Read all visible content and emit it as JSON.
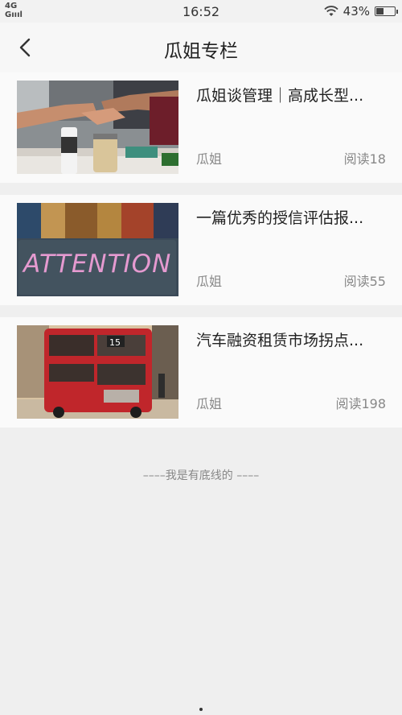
{
  "status": {
    "network": "4G",
    "time": "16:52",
    "battery": "43%",
    "battery_level": 0.43
  },
  "nav": {
    "title": "瓜姐专栏"
  },
  "articles": [
    {
      "title": "瓜姐谈管理｜高成长型...",
      "author": "瓜姐",
      "reads": "阅读18",
      "image": "hands-teamwork-photo"
    },
    {
      "title": "一篇优秀的授信评估报...",
      "author": "瓜姐",
      "reads": "阅读55",
      "image": "attention-chalkboard-photo",
      "image_text": "ATTENTION"
    },
    {
      "title": "汽车融资租赁市场拐点...",
      "author": "瓜姐",
      "reads": "阅读198",
      "image": "red-double-decker-bus-photo",
      "image_text": "15"
    }
  ],
  "footer": {
    "text": "––––我是有底线的 ––––"
  },
  "colors": {
    "background": "#efefef",
    "card": "#fafafa",
    "bus_red": "#c0262b",
    "chalk_pink": "#e59ad0"
  }
}
